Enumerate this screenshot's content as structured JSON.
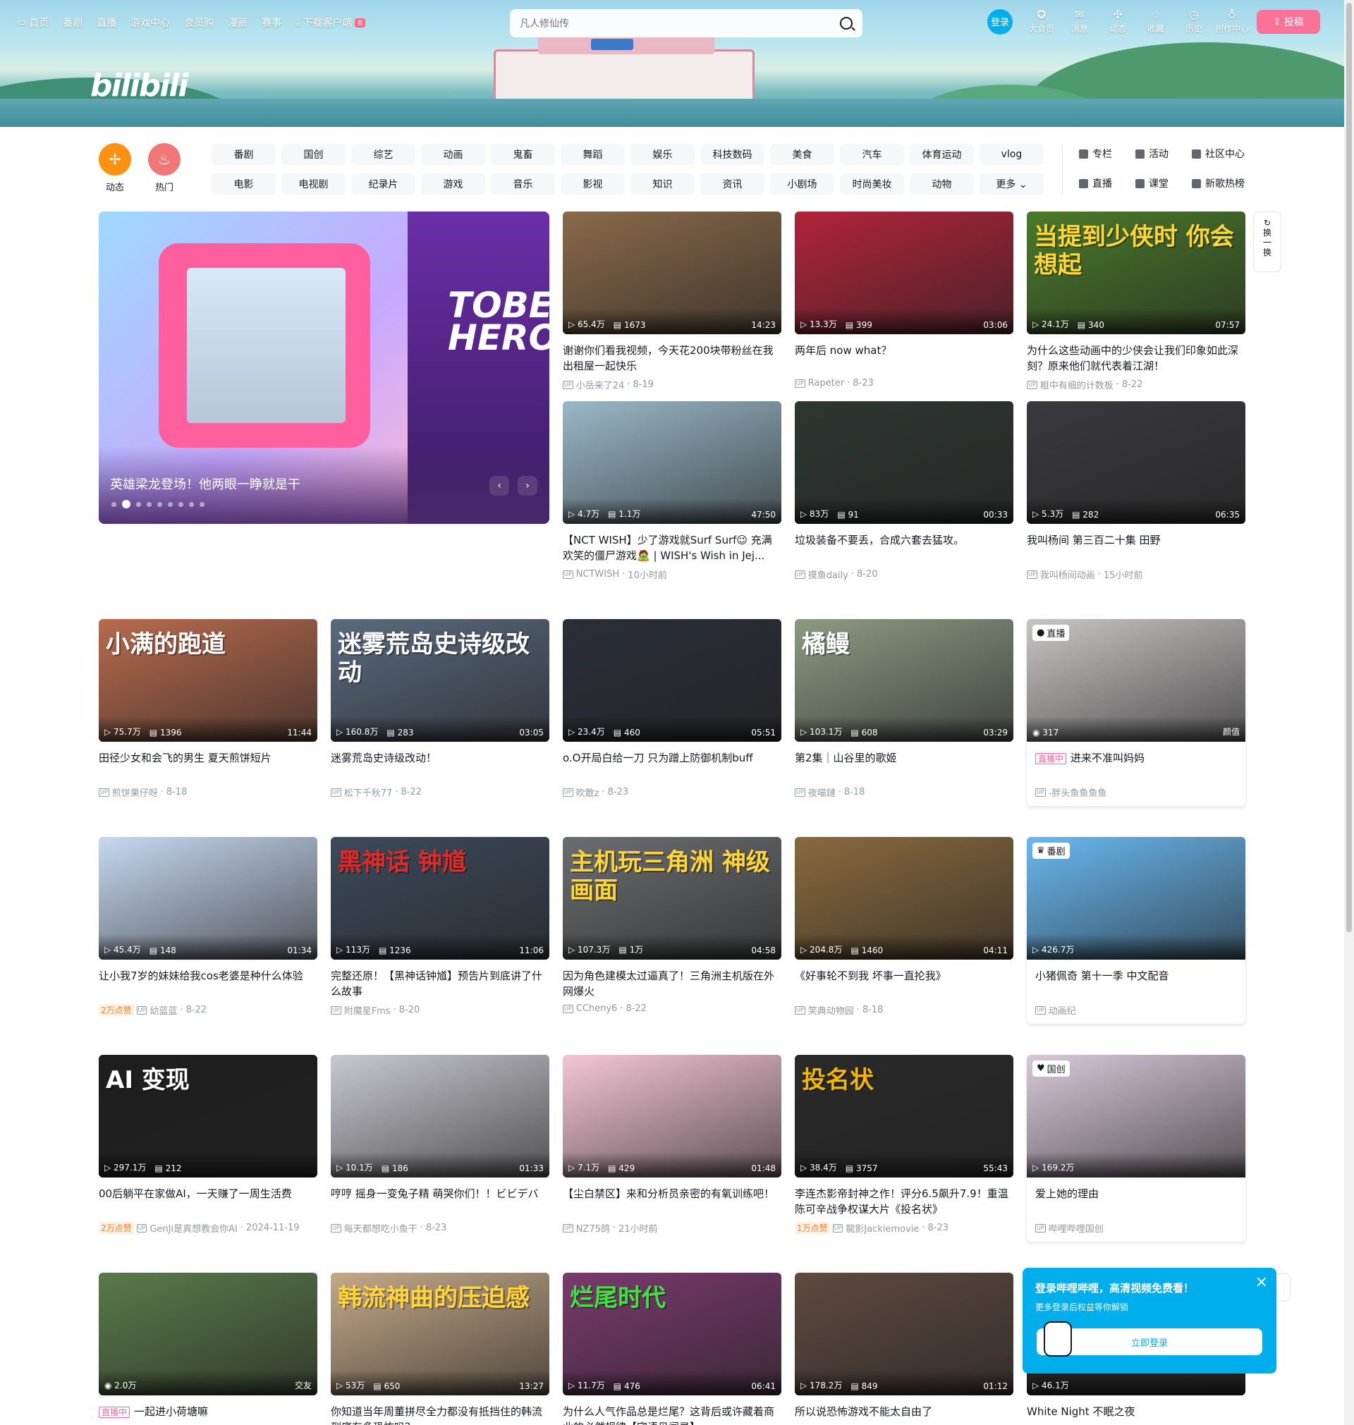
{
  "header": {
    "nav": [
      {
        "label": "首页",
        "icon": "tv-icon"
      },
      {
        "label": "番剧"
      },
      {
        "label": "直播"
      },
      {
        "label": "游戏中心"
      },
      {
        "label": "会员购"
      },
      {
        "label": "漫画"
      },
      {
        "label": "赛事"
      },
      {
        "label": "下载客户端",
        "icon": "download-icon",
        "badge": "新"
      }
    ],
    "logo": "bilibili",
    "search": {
      "placeholder": "凡人修仙传"
    },
    "login_label": "登录",
    "right": [
      {
        "label": "大会员",
        "icon": "vip-icon"
      },
      {
        "label": "消息",
        "icon": "message-icon"
      },
      {
        "label": "动态",
        "icon": "feed-icon"
      },
      {
        "label": "收藏",
        "icon": "star-icon"
      },
      {
        "label": "历史",
        "icon": "clock-icon"
      },
      {
        "label": "创作中心",
        "icon": "bulb-icon"
      }
    ],
    "upload_label": "投稿"
  },
  "channels": {
    "icons": [
      {
        "label": "动态",
        "color": "#ff9212"
      },
      {
        "label": "热门",
        "color": "#f07775"
      }
    ],
    "tags": [
      "番剧",
      "国创",
      "综艺",
      "动画",
      "鬼畜",
      "舞蹈",
      "娱乐",
      "科技数码",
      "美食",
      "汽车",
      "体育运动",
      "vlog",
      "电影",
      "电视剧",
      "纪录片",
      "游戏",
      "音乐",
      "影视",
      "知识",
      "资讯",
      "小剧场",
      "时尚美妆",
      "动物",
      "更多"
    ],
    "side": [
      "专栏",
      "活动",
      "社区中心",
      "直播",
      "课堂",
      "新歌热榜"
    ]
  },
  "carousel": {
    "title": "英雄梁龙登场！他两眼一睁就是干",
    "hero_text": "TOBE HERO",
    "dot_count": 9
  },
  "refresh_label": [
    "换",
    "一",
    "换"
  ],
  "videos": [
    {
      "title": "谢谢你们看我视频，今天花200块带粉丝在我出租屋一起快乐",
      "views": "65.4万",
      "danmaku": "1673",
      "duration": "14:23",
      "up": "小岳来了24",
      "date": "8-19",
      "color": "#8a6a4a"
    },
    {
      "title": "两年后 now what？",
      "views": "13.3万",
      "danmaku": "399",
      "duration": "03:06",
      "up": "Rapeter",
      "date": "8-23",
      "color": "#b2233a"
    },
    {
      "title": "为什么这些动画中的少侠会让我们印象如此深刻？原来他们就代表着江湖！",
      "views": "24.1万",
      "danmaku": "340",
      "duration": "07:57",
      "up": "粗中有细的计数板",
      "date": "8-22",
      "color": "#4a7a2a",
      "overlay": "当提到少侠时 你会想起",
      "ocolor": "#ffd53a"
    },
    {
      "title": "【NCT WISH】少了游戏就Surf Surf😉 充满欢笑的僵尸游戏🧟 | WISH's Wish in Jej...",
      "views": "4.7万",
      "danmaku": "1.1万",
      "duration": "47:50",
      "up": "NCTWISH",
      "date": "10小时前",
      "color": "#9ab8c8"
    },
    {
      "title": "垃圾装备不要丢，合成六套去猛攻。",
      "views": "83万",
      "danmaku": "91",
      "duration": "00:33",
      "up": "摸鱼daily",
      "date": "8-20",
      "color": "#2e3632"
    },
    {
      "title": "我叫杨间 第三百二十集 田野",
      "views": "5.3万",
      "danmaku": "282",
      "duration": "06:35",
      "up": "我叫杨间动画",
      "date": "15小时前",
      "color": "#3a3a3e"
    },
    {
      "title": "田径少女和会飞的男生 夏天煎饼短片",
      "views": "75.7万",
      "danmaku": "1396",
      "duration": "11:44",
      "up": "煎饼果仔呀",
      "date": "8-18",
      "color": "#b86b4e",
      "overlay": "小满的跑道",
      "ocolor": "#ffffff"
    },
    {
      "title": "迷雾荒岛史诗级改动！",
      "views": "160.8万",
      "danmaku": "283",
      "duration": "03:05",
      "up": "松下千秋77",
      "date": "8-22",
      "color": "#5a6a7e",
      "overlay": "迷雾荒岛史诗级改动",
      "ocolor": "#ffffff"
    },
    {
      "title": "o.O开局白给一刀 只为蹭上防御机制buff",
      "views": "23.4万",
      "danmaku": "460",
      "duration": "05:51",
      "up": "吹散z",
      "date": "8-23",
      "color": "#2a2e38"
    },
    {
      "title": "第2集｜山谷里的歌姬",
      "views": "103.1万",
      "danmaku": "608",
      "duration": "03:29",
      "up": "夜喵鏈",
      "date": "8-18",
      "color": "#8c9a84",
      "overlay": "橘鳗",
      "ocolor": "#ffffff"
    },
    {
      "title": "让小我7岁的妹妹给我cos老婆是种什么体验",
      "views": "45.4万",
      "danmaku": "148",
      "duration": "01:34",
      "up": "幼蓝蓝",
      "date": "8-22",
      "color": "#c7d8f0",
      "hot": "2万点赞"
    },
    {
      "title": "完整还原！【黑神话钟馗】预告片到底讲了什么故事",
      "views": "113万",
      "danmaku": "1236",
      "duration": "11:06",
      "up": "附魔星Fms",
      "date": "8-20",
      "color": "#3d4a5a",
      "overlay": "黑神话 钟馗",
      "ocolor": "#e02a2a"
    },
    {
      "title": "因为角色建模太过逼真了！三角洲主机版在外网爆火",
      "views": "107.3万",
      "danmaku": "1万",
      "duration": "04:58",
      "up": "CCheny6",
      "date": "8-22",
      "color": "#6b6e70",
      "overlay": "主机玩三角洲 神级画面",
      "ocolor": "#ffd53a"
    },
    {
      "title": "《好事轮不到我 坏事一直抡我》",
      "views": "204.8万",
      "danmaku": "1460",
      "duration": "04:11",
      "up": "笑典动物园",
      "date": "8-18",
      "color": "#8a6a3e"
    },
    {
      "title": "00后躺平在家做AI，一天赚了一周生活费",
      "views": "297.1万",
      "danmaku": "212",
      "duration": "",
      "up": "GenJi是真想教会你AI",
      "date": "2024-11-19",
      "color": "#1e1e1e",
      "overlay": "AI 变现",
      "ocolor": "#ffffff",
      "hot": "2万点赞"
    },
    {
      "title": "哼哼 摇身一变兔子精 萌哭你们！！ビビデバ",
      "views": "10.1万",
      "danmaku": "186",
      "duration": "01:33",
      "up": "每天都想吃小鱼干",
      "date": "8-23",
      "color": "#c8c8d0"
    },
    {
      "title": "【尘白禁区】来和分析员亲密的有氧训练吧！",
      "views": "7.1万",
      "danmaku": "429",
      "duration": "01:48",
      "up": "NZ75鸽",
      "date": "21小时前",
      "color": "#f4c6d6"
    },
    {
      "title": "李连杰影帝封神之作！评分6.5飙升7.9！重温陈可辛战争权谋大片《投名状》",
      "views": "38.4万",
      "danmaku": "3757",
      "duration": "55:43",
      "up": "龍影Jackiemovie",
      "date": "8-23",
      "color": "#2a2a2a",
      "overlay": "投名状",
      "ocolor": "#f5b500",
      "hot": "1万点赞"
    },
    {
      "title": "",
      "views": "2.0万",
      "danmaku": "",
      "duration": "交友",
      "up": "",
      "date": "",
      "color": "#5a7a4a"
    },
    {
      "title": "你知道当年周董拼尽全力都没有抵挡住的韩流到底有多恐怖吗？",
      "views": "53万",
      "danmaku": "650",
      "duration": "13:27",
      "up": "",
      "date": "",
      "color": "#c4a888",
      "overlay": "韩流神曲的压迫感",
      "ocolor": "#ffd53a"
    },
    {
      "title": "为什么人气作品总是烂尾？这背后或许藏着商业的必然规律【宅语见闻录】",
      "views": "11.7万",
      "danmaku": "476",
      "duration": "06:41",
      "up": "",
      "date": "",
      "color": "#7a3a6e",
      "overlay": "烂尾时代",
      "ocolor": "#3fe33f"
    },
    {
      "title": "所以说恐怖游戏不能太自由了",
      "views": "178.2万",
      "danmaku": "849",
      "duration": "01:12",
      "up": "",
      "date": "",
      "color": "#5e4a40"
    }
  ],
  "specials": [
    {
      "type": "live",
      "badge": "直播",
      "title": "进来不准叫妈妈",
      "live_label": "直播中",
      "viewers": "317",
      "tag": "颜值",
      "up": "-胖头鱼鱼鱼鱼",
      "color": "#c8c4c4"
    },
    {
      "type": "bangumi",
      "badge": "番剧",
      "title": "小猪佩奇 第十一季 中文配音",
      "views": "426.7万",
      "up": "动画纪",
      "color": "#69b8f0"
    },
    {
      "type": "guochuang",
      "badge": "国创",
      "title": "爱上她的理由",
      "views": "169.2万",
      "up": "哔哩哔哩国创",
      "color": "#d8c8d8"
    },
    {
      "type": "video",
      "title": "White Night 不眠之夜",
      "views": "46.1万",
      "color": "#2a2a2a"
    }
  ],
  "live_card": {
    "title": "一起进小荷塘嘛",
    "live_label": "直播中"
  },
  "popup": {
    "title": "登录哔哩哔哩，高清视频免费看！",
    "subtitle": "更多登录后权益等你解锁",
    "button": "立即登录"
  }
}
